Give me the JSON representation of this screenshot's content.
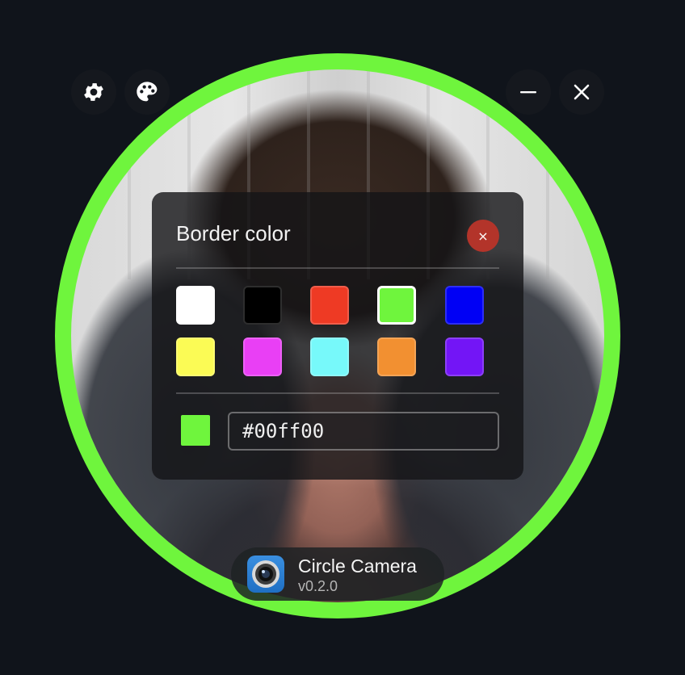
{
  "app": {
    "name": "Circle Camera",
    "version": "v0.2.0",
    "icon": "camera-lens-icon"
  },
  "toolbar": {
    "settings_icon": "gear-icon",
    "palette_icon": "palette-icon",
    "minimize_icon": "minimize-icon",
    "close_icon": "close-icon"
  },
  "border_color_dialog": {
    "title": "Border color",
    "close_label": "×",
    "swatches": [
      {
        "color": "#ffffff",
        "selected": false
      },
      {
        "color": "#000000",
        "selected": false
      },
      {
        "color": "#ee3a24",
        "selected": false
      },
      {
        "color": "#6ff53d",
        "selected": true
      },
      {
        "color": "#0000f5",
        "selected": false
      },
      {
        "color": "#fbfb55",
        "selected": false
      },
      {
        "color": "#e93ff5",
        "selected": false
      },
      {
        "color": "#77f9fa",
        "selected": false
      },
      {
        "color": "#f29031",
        "selected": false
      },
      {
        "color": "#7315f6",
        "selected": false
      }
    ],
    "hex_value": "#00ff00",
    "preview_color": "#6ff53d"
  },
  "colors": {
    "border": "#6ff53d",
    "close_button": "#b3342a",
    "background": "#10141b"
  }
}
